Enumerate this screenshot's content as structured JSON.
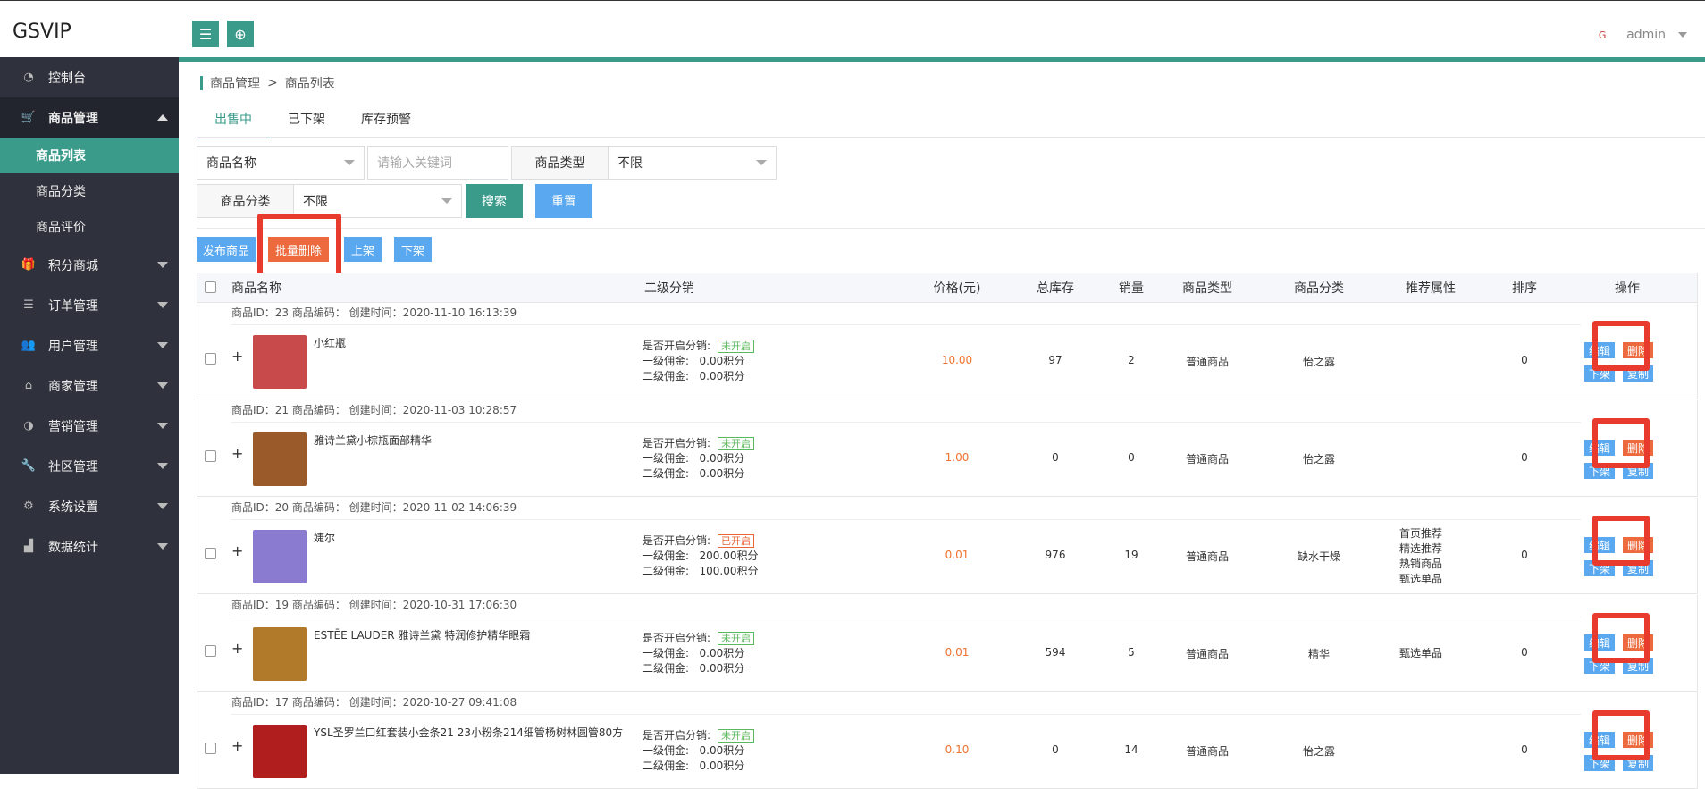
{
  "header": {
    "logo": "GSVIP",
    "user_name": "admin",
    "avatar_text": "G"
  },
  "sidebar": {
    "items": [
      {
        "label": "控制台",
        "icon": "dashboard-icon"
      },
      {
        "label": "商品管理",
        "icon": "cart-icon",
        "open": true,
        "children": [
          {
            "label": "商品列表",
            "active": true
          },
          {
            "label": "商品分类"
          },
          {
            "label": "商品评价"
          }
        ]
      },
      {
        "label": "积分商城",
        "icon": "gift-icon"
      },
      {
        "label": "订单管理",
        "icon": "list-icon"
      },
      {
        "label": "用户管理",
        "icon": "users-icon"
      },
      {
        "label": "商家管理",
        "icon": "home-icon"
      },
      {
        "label": "营销管理",
        "icon": "dashboard-gauge-icon"
      },
      {
        "label": "社区管理",
        "icon": "wrench-icon"
      },
      {
        "label": "系统设置",
        "icon": "gears-icon"
      },
      {
        "label": "数据统计",
        "icon": "area-chart-icon"
      }
    ]
  },
  "breadcrumb": {
    "parent": "商品管理",
    "sep": ">",
    "current": "商品列表"
  },
  "tabs": [
    {
      "label": "出售中"
    },
    {
      "label": "已下架"
    },
    {
      "label": "库存预警"
    }
  ],
  "filters": {
    "field_select": "商品名称",
    "keyword_placeholder": "请输入关键词",
    "type_label": "商品类型",
    "type_value": "不限",
    "category_label": "商品分类",
    "category_value": "不限",
    "search": "搜索",
    "reset": "重置"
  },
  "actions": {
    "publish": "发布商品",
    "batch_delete": "批量删除",
    "shelve": "上架",
    "unshelve": "下架"
  },
  "columns": [
    "商品名称",
    "二级分销",
    "价格(元)",
    "总库存",
    "销量",
    "商品类型",
    "商品分类",
    "推荐属性",
    "排序",
    "操作"
  ],
  "dist_labels": {
    "enabled": "是否开启分销:",
    "first": "一级佣金:",
    "second": "二级佣金:"
  },
  "op_labels": {
    "edit": "编辑",
    "delete": "删除",
    "unshelve": "下架",
    "copy": "复制"
  },
  "products": [
    {
      "meta": "商品ID：23 商品编码：   创建时间：2020-11-10 16:13:39",
      "name": "小红瓶",
      "dist_status": "未开启",
      "dist_on": false,
      "first": "0.00积分",
      "second": "0.00积分",
      "price": "10.00",
      "stock": "97",
      "sales": "2",
      "type": "普通商品",
      "category": "怡之露",
      "recommend": [],
      "sort": "0",
      "thumb_color": "#c94a4a"
    },
    {
      "meta": "商品ID：21 商品编码：   创建时间：2020-11-03 10:28:57",
      "name": "雅诗兰黛小棕瓶面部精华",
      "dist_status": "未开启",
      "dist_on": false,
      "first": "0.00积分",
      "second": "0.00积分",
      "price": "1.00",
      "stock": "0",
      "sales": "0",
      "type": "普通商品",
      "category": "怡之露",
      "recommend": [],
      "sort": "0",
      "thumb_color": "#9a5a2a"
    },
    {
      "meta": "商品ID：20 商品编码：   创建时间：2020-11-02 14:06:39",
      "name": "婕尔",
      "dist_status": "已开启",
      "dist_on": true,
      "first": "200.00积分",
      "second": "100.00积分",
      "price": "0.01",
      "stock": "976",
      "sales": "19",
      "type": "普通商品",
      "category": "缺水干燥",
      "recommend": [
        "首页推荐",
        "精选推荐",
        "热销商品",
        "甄选单品"
      ],
      "sort": "0",
      "thumb_color": "#8a7ad0"
    },
    {
      "meta": "商品ID：19 商品编码：   创建时间：2020-10-31 17:06:30",
      "name": "ESTĒE LAUDER 雅诗兰黛 特润修护精华眼霜",
      "dist_status": "未开启",
      "dist_on": false,
      "first": "0.00积分",
      "second": "0.00积分",
      "price": "0.01",
      "stock": "594",
      "sales": "5",
      "type": "普通商品",
      "category": "精华",
      "recommend": [
        "甄选单品"
      ],
      "sort": "0",
      "thumb_color": "#b07a2a"
    },
    {
      "meta": "商品ID：17 商品编码：   创建时间：2020-10-27 09:41:08",
      "name": "YSL圣罗兰口红套装小金条21 23小粉条214细管杨树林圆管80方",
      "dist_status": "未开启",
      "dist_on": false,
      "first": "0.00积分",
      "second": "0.00积分",
      "price": "0.10",
      "stock": "0",
      "sales": "14",
      "type": "普通商品",
      "category": "怡之露",
      "recommend": [],
      "sort": "0",
      "thumb_color": "#b01e1e"
    }
  ]
}
